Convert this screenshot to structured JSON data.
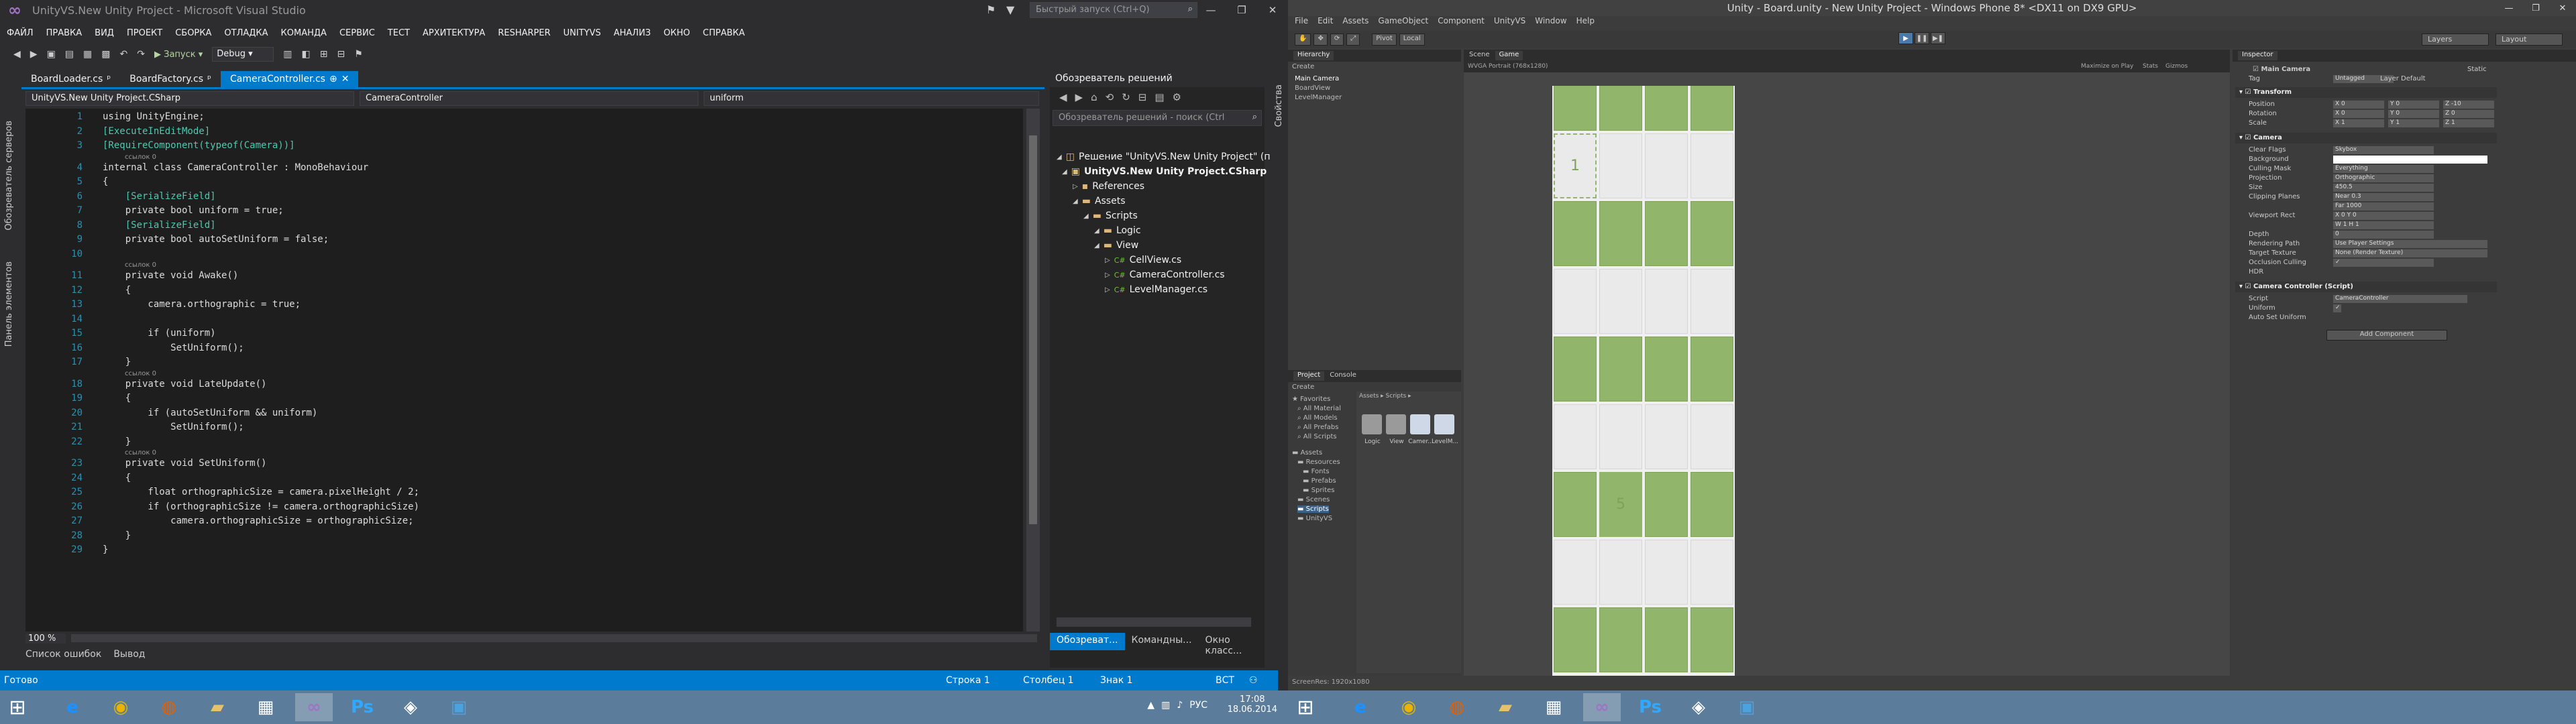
{
  "vs": {
    "title": "UnityVS.New Unity Project - Microsoft Visual Studio",
    "quick_launch_placeholder": "Быстрый запуск (Ctrl+Q)",
    "menu": [
      "ФАЙЛ",
      "ПРАВКА",
      "ВИД",
      "ПРОЕКТ",
      "СБОРКА",
      "ОТЛАДКА",
      "КОМАНДА",
      "СЕРВИС",
      "ТЕСТ",
      "АРХИТЕКТУРА",
      "RESHARPER",
      "UNITYVS",
      "АНАЛИЗ",
      "ОКНО",
      "СПРАВКА"
    ],
    "toolbar": {
      "start": "Запуск",
      "config": "Debug"
    },
    "left_strip": [
      "Обозреватель серверов",
      "Панель элементов"
    ],
    "right_strip": "Свойства",
    "tabs": [
      "BoardLoader.cs",
      "BoardFactory.cs",
      "CameraController.cs"
    ],
    "nav": [
      "UnityVS.New Unity Project.CSharp",
      "CameraController",
      "uniform"
    ],
    "code": [
      {
        "n": "1",
        "t": "using UnityEngine;",
        "c": ""
      },
      {
        "n": "2",
        "t": "[ExecuteInEditMode]",
        "c": "attr"
      },
      {
        "n": "3",
        "t": "[RequireComponent(typeof(Camera))]",
        "c": "attr"
      },
      {
        "n": "4",
        "t": "internal class CameraController : MonoBehaviour",
        "c": ""
      },
      {
        "n": "5",
        "t": "{",
        "c": ""
      },
      {
        "n": "6",
        "t": "    [SerializeField]",
        "c": "attr"
      },
      {
        "n": "7",
        "t": "    private bool uniform = true;",
        "c": ""
      },
      {
        "n": "8",
        "t": "    [SerializeField]",
        "c": "attr"
      },
      {
        "n": "9",
        "t": "    private bool autoSetUniform = false;",
        "c": ""
      },
      {
        "n": "10",
        "t": "",
        "c": ""
      },
      {
        "n": "11",
        "t": "    private void Awake()",
        "c": ""
      },
      {
        "n": "12",
        "t": "    {",
        "c": ""
      },
      {
        "n": "13",
        "t": "        camera.orthographic = true;",
        "c": ""
      },
      {
        "n": "14",
        "t": "",
        "c": ""
      },
      {
        "n": "15",
        "t": "        if (uniform)",
        "c": ""
      },
      {
        "n": "16",
        "t": "            SetUniform();",
        "c": ""
      },
      {
        "n": "17",
        "t": "    }",
        "c": ""
      },
      {
        "n": "18",
        "t": "    private void LateUpdate()",
        "c": ""
      },
      {
        "n": "19",
        "t": "    {",
        "c": ""
      },
      {
        "n": "20",
        "t": "        if (autoSetUniform && uniform)",
        "c": ""
      },
      {
        "n": "21",
        "t": "            SetUniform();",
        "c": ""
      },
      {
        "n": "22",
        "t": "    }",
        "c": ""
      },
      {
        "n": "23",
        "t": "    private void SetUniform()",
        "c": ""
      },
      {
        "n": "24",
        "t": "    {",
        "c": ""
      },
      {
        "n": "25",
        "t": "        float orthographicSize = camera.pixelHeight / 2;",
        "c": ""
      },
      {
        "n": "26",
        "t": "        if (orthographicSize != camera.orthographicSize)",
        "c": ""
      },
      {
        "n": "27",
        "t": "            camera.orthographicSize = orthographicSize;",
        "c": ""
      },
      {
        "n": "28",
        "t": "    }",
        "c": ""
      },
      {
        "n": "29",
        "t": "}",
        "c": ""
      }
    ],
    "ref_hint": "ссылок 0",
    "zoom": "100 %",
    "bottom_tabs": [
      "Список ошибок",
      "Вывод"
    ],
    "status": {
      "ready": "Готово",
      "line": "Строка 1",
      "col": "Столбец 1",
      "char": "Знак 1",
      "mode": "ВСТ"
    },
    "solution": {
      "title": "Обозреватель решений",
      "search_placeholder": "Обозреватель решений - поиск (Ctrl",
      "items": [
        {
          "label": "Решение \"UnityVS.New Unity Project\" (п",
          "kind": "sol"
        },
        {
          "label": "UnityVS.New Unity Project.CSharp",
          "kind": "proj"
        },
        {
          "label": "References",
          "kind": "ref"
        },
        {
          "label": "Assets",
          "kind": "folder"
        },
        {
          "label": "Scripts",
          "kind": "folder"
        },
        {
          "label": "Logic",
          "kind": "folder"
        },
        {
          "label": "View",
          "kind": "folder"
        },
        {
          "label": "CellView.cs",
          "kind": "cs"
        },
        {
          "label": "CameraController.cs",
          "kind": "cs"
        },
        {
          "label": "LevelManager.cs",
          "kind": "cs"
        }
      ],
      "bottom_tabs": [
        "Обозреват...",
        "Командны...",
        "Окно класс..."
      ]
    }
  },
  "taskbar": {
    "time": "17:08",
    "date": "18.06.2014",
    "lang": "РУС",
    "apps": [
      {
        "name": "ie",
        "glyph": "e",
        "color": "#1e90ff"
      },
      {
        "name": "chrome",
        "glyph": "◉",
        "color": "#e8b400"
      },
      {
        "name": "firefox",
        "glyph": "◍",
        "color": "#e66000"
      },
      {
        "name": "explorer",
        "glyph": "▰",
        "color": "#e8c26a"
      },
      {
        "name": "metro",
        "glyph": "▦",
        "color": "#ffffff"
      },
      {
        "name": "visual-studio",
        "glyph": "∞",
        "color": "#a074c4"
      },
      {
        "name": "photoshop",
        "glyph": "Ps",
        "color": "#31a8ff"
      },
      {
        "name": "unity",
        "glyph": "◈",
        "color": "#ffffff"
      },
      {
        "name": "photos",
        "glyph": "▣",
        "color": "#4aa3df"
      }
    ]
  },
  "unity": {
    "title": "Unity - Board.unity - New Unity Project - Windows Phone 8* <DX11 on DX9 GPU>",
    "menu": [
      "File",
      "Edit",
      "Assets",
      "GameObject",
      "Component",
      "UnityVS",
      "Window",
      "Help"
    ],
    "toolbar": {
      "pivot": "Pivot",
      "local": "Local",
      "layers": "Layers",
      "layout": "Layout"
    },
    "hierarchy": {
      "tab": "Hierarchy",
      "create": "Create",
      "items": [
        "Main Camera",
        "BoardView",
        "LevelManager"
      ]
    },
    "scene_tabs": [
      "Scene",
      "Game"
    ],
    "game_bar": {
      "aspect": "WVGA Portrait (768x1280)",
      "maximize": "Maximize on Play",
      "stats": "Stats",
      "gizmos": "Gizmos"
    },
    "board": {
      "cols": 4,
      "rows": 9,
      "labels": [
        {
          "index": 4,
          "text": "1"
        },
        {
          "index": 25,
          "text": "5"
        }
      ]
    },
    "project": {
      "tabs": [
        "Project",
        "Console"
      ],
      "create": "Create",
      "favorites": [
        "Favorites",
        "All Material",
        "All Models",
        "All Prefabs",
        "All Scripts"
      ],
      "tree": [
        "Assets",
        "Resources",
        "Fonts",
        "Prefabs",
        "Sprites",
        "Scenes",
        "Scripts",
        "UnityVS"
      ],
      "breadcrumb": "Assets ▸ Scripts ▸",
      "assets": [
        {
          "label": "Logic",
          "kind": "folder"
        },
        {
          "label": "View",
          "kind": "folder"
        },
        {
          "label": "Camer...",
          "kind": "script"
        },
        {
          "label": "LevelM...",
          "kind": "script"
        }
      ]
    },
    "inspector": {
      "tab": "Inspector",
      "object": "Main Camera",
      "tag": "Untagged",
      "layer": "Default",
      "static": "Static",
      "transform": {
        "title": "Transform",
        "rows": [
          [
            "Position",
            "X 0",
            "Y 0",
            "Z -10"
          ],
          [
            "Rotation",
            "X 0",
            "Y 0",
            "Z 0"
          ],
          [
            "Scale",
            "X 1",
            "Y 1",
            "Z 1"
          ]
        ]
      },
      "camera": {
        "title": "Camera",
        "rows": [
          [
            "Clear Flags",
            "Skybox"
          ],
          [
            "Background",
            ""
          ],
          [
            "Culling Mask",
            "Everything"
          ],
          [
            "Projection",
            "Orthographic"
          ],
          [
            "Size",
            "450.5"
          ],
          [
            "Clipping Planes",
            "Near 0.3"
          ],
          [
            "",
            "Far 1000"
          ],
          [
            "Viewport Rect",
            "X 0   Y 0"
          ],
          [
            "",
            "W 1   H 1"
          ],
          [
            "Depth",
            "0"
          ],
          [
            "Rendering Path",
            "Use Player Settings"
          ],
          [
            "Target Texture",
            "None (Render Texture)"
          ],
          [
            "Occlusion Culling",
            "✓"
          ],
          [
            "HDR",
            ""
          ]
        ]
      },
      "script": {
        "title": "Camera Controller (Script)",
        "rows": [
          [
            "Script",
            "CameraController"
          ],
          [
            "Uniform",
            "✓"
          ],
          [
            "Auto Set Uniform",
            ""
          ]
        ]
      },
      "add_component": "Add Component"
    },
    "status": "ScreenRes: 1920x1080"
  }
}
